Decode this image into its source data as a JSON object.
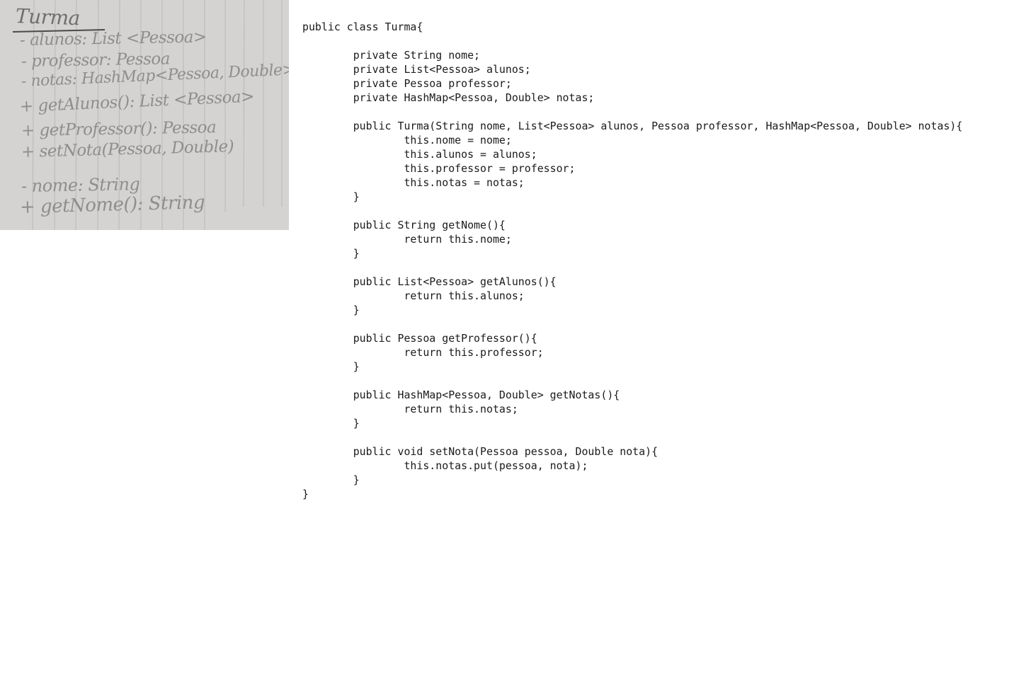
{
  "handwritten_note": {
    "title": "Turma",
    "lines": [
      "- alunos: List <Pessoa>",
      "- professor: Pessoa",
      "- notas: HashMap<Pessoa, Double>",
      "+ getAlunos(): List <Pessoa>",
      "+ getProfessor(): Pessoa",
      "+ setNota(Pessoa, Double)",
      "- nome: String",
      "+ getNome(): String"
    ]
  },
  "code": {
    "lines": [
      "public class Turma{",
      "",
      "        private String nome;",
      "        private List<Pessoa> alunos;",
      "        private Pessoa professor;",
      "        private HashMap<Pessoa, Double> notas;",
      "",
      "        public Turma(String nome, List<Pessoa> alunos, Pessoa professor, HashMap<Pessoa, Double> notas){",
      "                this.nome = nome;",
      "                this.alunos = alunos;",
      "                this.professor = professor;",
      "                this.notas = notas;",
      "        }",
      "",
      "        public String getNome(){",
      "                return this.nome;",
      "        }",
      "",
      "        public List<Pessoa> getAlunos(){",
      "                return this.alunos;",
      "        }",
      "",
      "        public Pessoa getProfessor(){",
      "                return this.professor;",
      "        }",
      "",
      "        public HashMap<Pessoa, Double> getNotas(){",
      "                return this.notas;",
      "        }",
      "",
      "        public void setNota(Pessoa pessoa, Double nota){",
      "                this.notas.put(pessoa, nota);",
      "        }",
      "}"
    ]
  }
}
